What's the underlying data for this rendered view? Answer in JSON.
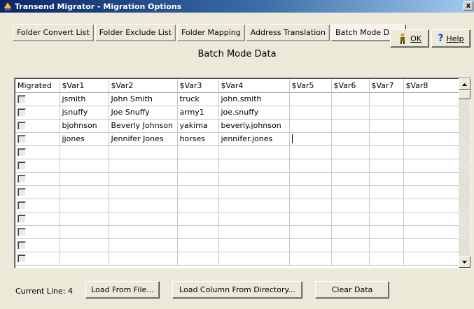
{
  "window": {
    "title": "Transend Migrator - Migration Options",
    "close_glyph": "x"
  },
  "tabs": [
    {
      "label": "Folder Convert List"
    },
    {
      "label": "Folder Exclude List"
    },
    {
      "label": "Folder Mapping"
    },
    {
      "label": "Address Translation"
    },
    {
      "label": "Batch Mode Data",
      "active": true
    }
  ],
  "buttons": {
    "ok_label": "OK",
    "help_label": "Help"
  },
  "section_title": "Batch Mode Data",
  "grid": {
    "columns": [
      "Migrated",
      "$Var1",
      "$Var2",
      "$Var3",
      "$Var4",
      "$Var5",
      "$Var6",
      "$Var7",
      "$Var8"
    ],
    "rows": [
      [
        "",
        "jsmith",
        "John Smith",
        "truck",
        "john.smith",
        "",
        "",
        "",
        ""
      ],
      [
        "",
        "jsnuffy",
        "Joe Snuffy",
        "army1",
        "joe.snuffy",
        "",
        "",
        "",
        ""
      ],
      [
        "",
        "bjohnson",
        "Beverly Johnson",
        "yakima",
        "beverly.johnson",
        "",
        "",
        "",
        ""
      ],
      [
        "",
        "jjones",
        "Jennifer Jones",
        "horses",
        "jennifer.jones",
        "",
        "",
        "",
        ""
      ],
      [
        "",
        "",
        "",
        "",
        "",
        "",
        "",
        "",
        ""
      ],
      [
        "",
        "",
        "",
        "",
        "",
        "",
        "",
        "",
        ""
      ],
      [
        "",
        "",
        "",
        "",
        "",
        "",
        "",
        "",
        ""
      ],
      [
        "",
        "",
        "",
        "",
        "",
        "",
        "",
        "",
        ""
      ],
      [
        "",
        "",
        "",
        "",
        "",
        "",
        "",
        "",
        ""
      ],
      [
        "",
        "",
        "",
        "",
        "",
        "",
        "",
        "",
        ""
      ],
      [
        "",
        "",
        "",
        "",
        "",
        "",
        "",
        "",
        ""
      ],
      [
        "",
        "",
        "",
        "",
        "",
        "",
        "",
        "",
        ""
      ],
      [
        "",
        "",
        "",
        "",
        "",
        "",
        "",
        "",
        ""
      ]
    ],
    "migrated_checked": [
      false,
      false,
      false,
      false,
      false,
      false,
      false,
      false,
      false,
      false,
      false,
      false,
      false
    ],
    "caret_row": 3
  },
  "status": {
    "current_line": "Current Line: 4"
  },
  "actions": {
    "load_file_label": "Load From File...",
    "load_column_label": "Load Column From Directory...",
    "clear_label": "Clear Data"
  },
  "colors": {
    "title_start": "#0a246a",
    "title_end": "#a6caf0",
    "face": "#ece9d8",
    "help_icon": "#1a44c8",
    "ok_icon": "#c8a030"
  },
  "icons": {
    "app": "app-icon",
    "ok": "ok-figure-icon",
    "help": "question-icon",
    "scroll_up": "arrow-up-icon",
    "scroll_down": "arrow-down-icon"
  }
}
